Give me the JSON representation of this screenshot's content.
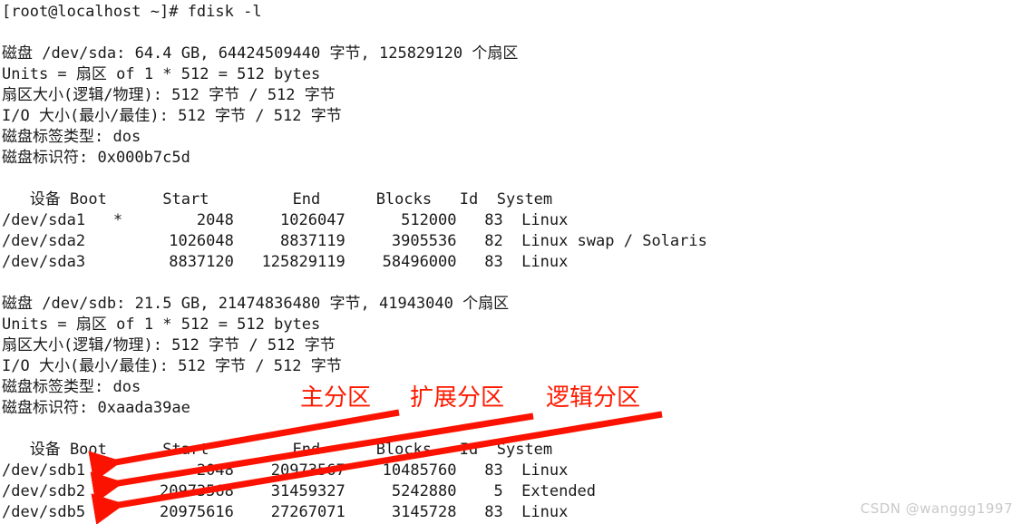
{
  "terminal": {
    "prompt_line": "[root@localhost ~]# fdisk -l",
    "disks": [
      {
        "summary": "磁盘 /dev/sda: 64.4 GB, 64424509440 字节, 125829120 个扇区",
        "units": "Units = 扇区 of 1 * 512 = 512 bytes",
        "sector_size": "扇区大小(逻辑/物理): 512 字节 / 512 字节",
        "io_size": "I/O 大小(最小/最佳): 512 字节 / 512 字节",
        "label_type": "磁盘标签类型: dos",
        "identifier": "磁盘标识符: 0x000b7c5d",
        "table_header": "   设备 Boot      Start         End      Blocks   Id  System",
        "rows": [
          "/dev/sda1   *        2048     1026047      512000   83  Linux",
          "/dev/sda2         1026048     8837119     3905536   82  Linux swap / Solaris",
          "/dev/sda3         8837120   125829119    58496000   83  Linux"
        ]
      },
      {
        "summary": "磁盘 /dev/sdb: 21.5 GB, 21474836480 字节, 41943040 个扇区",
        "units": "Units = 扇区 of 1 * 512 = 512 bytes",
        "sector_size": "扇区大小(逻辑/物理): 512 字节 / 512 字节",
        "io_size": "I/O 大小(最小/最佳): 512 字节 / 512 字节",
        "label_type": "磁盘标签类型: dos",
        "identifier": "磁盘标识符: 0xaada39ae",
        "table_header": "   设备 Boot      Start         End      Blocks   Id  System",
        "rows": [
          "/dev/sdb1            2048    20973567    10485760   83  Linux",
          "/dev/sdb2        20973568    31459327     5242880    5  Extended",
          "/dev/sdb5        20975616    27267071     3145728   83  Linux"
        ]
      }
    ]
  },
  "annotations": {
    "color": "#ff1a00",
    "labels": [
      {
        "id": "primary",
        "text": "主分区",
        "target": "/dev/sdb1"
      },
      {
        "id": "extended",
        "text": "扩展分区",
        "target": "/dev/sdb2"
      },
      {
        "id": "logical",
        "text": "逻辑分区",
        "target": "/dev/sdb5"
      }
    ]
  },
  "watermark": {
    "text": "CSDN @wanggg1997"
  }
}
